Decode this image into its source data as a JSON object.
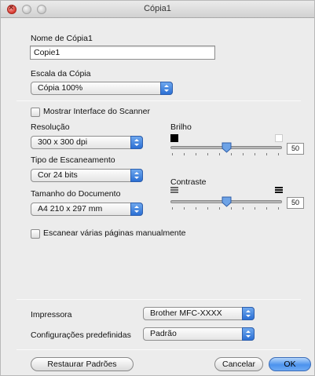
{
  "window": {
    "title": "Cópia1"
  },
  "copy_name": {
    "label": "Nome de Cópia1",
    "value": "Copie1"
  },
  "copy_scale": {
    "label": "Escala da Cópia",
    "value": "Cópia 100%"
  },
  "scanner": {
    "show_interface_label": "Mostrar Interface do Scanner",
    "show_interface_checked": false,
    "resolution_label": "Resolução",
    "resolution_value": "300 x 300 dpi",
    "scan_type_label": "Tipo de Escaneamento",
    "scan_type_value": "Cor 24 bits",
    "document_size_label": "Tamanho do Documento",
    "document_size_value": "A4 210 x 297 mm",
    "brightness_label": "Brilho",
    "brightness_value": "50",
    "contrast_label": "Contraste",
    "contrast_value": "50",
    "manual_multipage_label": "Escanear várias páginas manualmente",
    "manual_multipage_checked": false
  },
  "printer": {
    "label": "Impressora",
    "value": "Brother MFC-XXXX"
  },
  "presets": {
    "label": "Configurações predefinidas",
    "value": "Padrão"
  },
  "buttons": {
    "restore": "Restaurar Padrões",
    "cancel": "Cancelar",
    "ok": "OK"
  },
  "icons": {
    "brightness_low": "black-square-icon",
    "brightness_high": "white-square-icon",
    "contrast_low": "low-contrast-icon",
    "contrast_high": "high-contrast-icon"
  },
  "colors": {
    "accent": "#3d86e8",
    "close_button": "#d8372e"
  }
}
